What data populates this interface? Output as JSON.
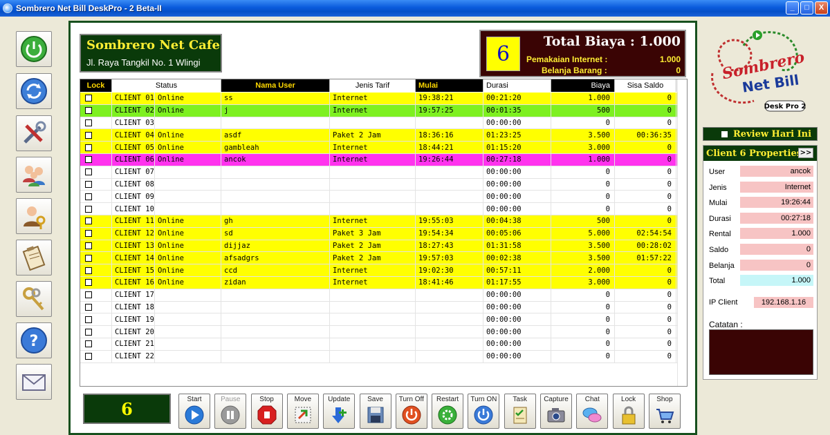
{
  "window": {
    "title": "Sombrero Net Bill DeskPro - 2 Beta-II",
    "controls": [
      "_",
      "□",
      "X"
    ]
  },
  "left_toolbar": [
    {
      "icon": "power-icon",
      "name": "power"
    },
    {
      "icon": "refresh-icon",
      "name": "refresh"
    },
    {
      "icon": "tools-icon",
      "name": "tools"
    },
    {
      "icon": "users-icon",
      "name": "users"
    },
    {
      "icon": "operator-key-icon",
      "name": "operator"
    },
    {
      "icon": "clipboard-icon",
      "name": "report"
    },
    {
      "icon": "keys-icon",
      "name": "keys"
    },
    {
      "icon": "help-icon",
      "name": "help"
    },
    {
      "icon": "mail-icon",
      "name": "mail"
    }
  ],
  "cafe": {
    "name": "Sombrero Net Cafe",
    "address": "Jl. Raya Tangkil No. 1 Wlingi"
  },
  "total": {
    "title": "Total Biaya : 1.000",
    "active_count": "6",
    "internet_label": "Pemakaian Internet :",
    "internet_value": "1.000",
    "goods_label": "Belanja Barang :",
    "goods_value": "0"
  },
  "grid": {
    "headers": {
      "lock": "Lock",
      "status": "Status",
      "user": "Nama User",
      "tarif": "Jenis Tarif",
      "mulai": "Mulai",
      "durasi": "Durasi",
      "biaya": "Biaya",
      "sisa": "Sisa Saldo"
    },
    "rows": [
      {
        "client": "CLIENT 01",
        "status": "Online",
        "user": "ss",
        "tarif": "Internet",
        "mulai": "19:38:21",
        "durasi": "00:21:20",
        "biaya": "1.000",
        "sisa": "0",
        "style": "online"
      },
      {
        "client": "CLIENT 02",
        "status": "Online",
        "user": "j",
        "tarif": "Internet",
        "mulai": "19:57:25",
        "durasi": "00:01:35",
        "biaya": "500",
        "sisa": "0",
        "style": "green"
      },
      {
        "client": "CLIENT 03",
        "status": "",
        "user": "",
        "tarif": "",
        "mulai": "",
        "durasi": "00:00:00",
        "biaya": "0",
        "sisa": "0",
        "style": ""
      },
      {
        "client": "CLIENT 04",
        "status": "Online",
        "user": "asdf",
        "tarif": "Paket 2 Jam",
        "mulai": "18:36:16",
        "durasi": "01:23:25",
        "biaya": "3.500",
        "sisa": "00:36:35",
        "style": "online"
      },
      {
        "client": "CLIENT 05",
        "status": "Online",
        "user": "gambleah",
        "tarif": "Internet",
        "mulai": "18:44:21",
        "durasi": "01:15:20",
        "biaya": "3.000",
        "sisa": "0",
        "style": "online"
      },
      {
        "client": "CLIENT 06",
        "status": "Online",
        "user": "ancok",
        "tarif": "Internet",
        "mulai": "19:26:44",
        "durasi": "00:27:18",
        "biaya": "1.000",
        "sisa": "0",
        "style": "magenta"
      },
      {
        "client": "CLIENT 07",
        "status": "",
        "user": "",
        "tarif": "",
        "mulai": "",
        "durasi": "00:00:00",
        "biaya": "0",
        "sisa": "0",
        "style": ""
      },
      {
        "client": "CLIENT 08",
        "status": "",
        "user": "",
        "tarif": "",
        "mulai": "",
        "durasi": "00:00:00",
        "biaya": "0",
        "sisa": "0",
        "style": ""
      },
      {
        "client": "CLIENT 09",
        "status": "",
        "user": "",
        "tarif": "",
        "mulai": "",
        "durasi": "00:00:00",
        "biaya": "0",
        "sisa": "0",
        "style": ""
      },
      {
        "client": "CLIENT 10",
        "status": "",
        "user": "",
        "tarif": "",
        "mulai": "",
        "durasi": "00:00:00",
        "biaya": "0",
        "sisa": "0",
        "style": ""
      },
      {
        "client": "CLIENT 11",
        "status": "Online",
        "user": "gh",
        "tarif": "Internet",
        "mulai": "19:55:03",
        "durasi": "00:04:38",
        "biaya": "500",
        "sisa": "0",
        "style": "online"
      },
      {
        "client": "CLIENT 12",
        "status": "Online",
        "user": "sd",
        "tarif": "Paket 3 Jam",
        "mulai": "19:54:34",
        "durasi": "00:05:06",
        "biaya": "5.000",
        "sisa": "02:54:54",
        "style": "online"
      },
      {
        "client": "CLIENT 13",
        "status": "Online",
        "user": "dijjaz",
        "tarif": "Paket 2 Jam",
        "mulai": "18:27:43",
        "durasi": "01:31:58",
        "biaya": "3.500",
        "sisa": "00:28:02",
        "style": "online"
      },
      {
        "client": "CLIENT 14",
        "status": "Online",
        "user": "afsadgrs",
        "tarif": "Paket 2 Jam",
        "mulai": "19:57:03",
        "durasi": "00:02:38",
        "biaya": "3.500",
        "sisa": "01:57:22",
        "style": "online"
      },
      {
        "client": "CLIENT 15",
        "status": "Online",
        "user": "ccd",
        "tarif": "Internet",
        "mulai": "19:02:30",
        "durasi": "00:57:11",
        "biaya": "2.000",
        "sisa": "0",
        "style": "online"
      },
      {
        "client": "CLIENT 16",
        "status": "Online",
        "user": "zidan",
        "tarif": "Internet",
        "mulai": "18:41:46",
        "durasi": "01:17:55",
        "biaya": "3.000",
        "sisa": "0",
        "style": "online"
      },
      {
        "client": "CLIENT 17",
        "status": "",
        "user": "",
        "tarif": "",
        "mulai": "",
        "durasi": "00:00:00",
        "biaya": "0",
        "sisa": "0",
        "style": ""
      },
      {
        "client": "CLIENT 18",
        "status": "",
        "user": "",
        "tarif": "",
        "mulai": "",
        "durasi": "00:00:00",
        "biaya": "0",
        "sisa": "0",
        "style": ""
      },
      {
        "client": "CLIENT 19",
        "status": "",
        "user": "",
        "tarif": "",
        "mulai": "",
        "durasi": "00:00:00",
        "biaya": "0",
        "sisa": "0",
        "style": ""
      },
      {
        "client": "CLIENT 20",
        "status": "",
        "user": "",
        "tarif": "",
        "mulai": "",
        "durasi": "00:00:00",
        "biaya": "0",
        "sisa": "0",
        "style": ""
      },
      {
        "client": "CLIENT 21",
        "status": "",
        "user": "",
        "tarif": "",
        "mulai": "",
        "durasi": "00:00:00",
        "biaya": "0",
        "sisa": "0",
        "style": ""
      },
      {
        "client": "CLIENT 22",
        "status": "",
        "user": "",
        "tarif": "",
        "mulai": "",
        "durasi": "00:00:00",
        "biaya": "0",
        "sisa": "0",
        "style": ""
      }
    ]
  },
  "bottom": {
    "count": "6",
    "buttons": [
      {
        "label": "Start",
        "icon": "play-icon",
        "enabled": true
      },
      {
        "label": "Pause",
        "icon": "pause-icon",
        "enabled": false
      },
      {
        "label": "Stop",
        "icon": "stop-hand-icon",
        "enabled": true
      },
      {
        "label": "Move",
        "icon": "move-icon",
        "enabled": true
      },
      {
        "label": "Update",
        "icon": "update-icon",
        "enabled": true
      },
      {
        "label": "Save",
        "icon": "save-icon",
        "enabled": true
      },
      {
        "label": "Turn Off",
        "icon": "turn-off-icon",
        "enabled": true
      },
      {
        "label": "Restart",
        "icon": "restart-icon",
        "enabled": true
      },
      {
        "label": "Turn ON",
        "icon": "turn-on-icon",
        "enabled": true
      },
      {
        "label": "Task",
        "icon": "task-icon",
        "enabled": true
      },
      {
        "label": "Capture",
        "icon": "camera-icon",
        "enabled": true
      },
      {
        "label": "Chat",
        "icon": "chat-icon",
        "enabled": true
      },
      {
        "label": "Lock",
        "icon": "lock-icon",
        "enabled": true
      },
      {
        "label": "Shop",
        "icon": "shop-cart-icon",
        "enabled": true
      }
    ]
  },
  "right_panel": {
    "logo_line1": "Sombrero",
    "logo_line2": "Net Bill",
    "logo_badge": "Desk Pro 2",
    "review_label": "Review Hari Ini",
    "props_title": "Client 6 Properties",
    "props_btn": ">>",
    "props": [
      {
        "label": "User",
        "value": "ancok"
      },
      {
        "label": "Jenis",
        "value": "Internet"
      },
      {
        "label": "Mulai",
        "value": "19:26:44"
      },
      {
        "label": "Durasi",
        "value": "00:27:18"
      },
      {
        "label": "Rental",
        "value": "1.000"
      },
      {
        "label": "Saldo",
        "value": "0"
      },
      {
        "label": "Belanja",
        "value": "0"
      },
      {
        "label": "Total",
        "value": "1.000"
      }
    ],
    "ip_label": "IP Client",
    "ip_value": "192.168.1.16",
    "catatan_label": "Catatan :"
  }
}
